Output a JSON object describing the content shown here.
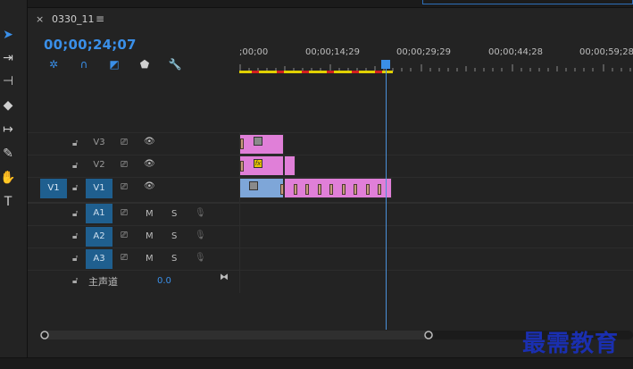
{
  "panel": {
    "close_glyph": "×",
    "title": "0330_11",
    "menu_glyph": "≡",
    "timecode": "00;00;24;07"
  },
  "ruler": {
    "labels": [
      ";00;00",
      "00;00;14;29",
      "00;00;29;29",
      "00;00;44;28",
      "00;00;59;28"
    ]
  },
  "video_tracks": [
    {
      "src": "",
      "target": "V3"
    },
    {
      "src": "",
      "target": "V2"
    },
    {
      "src": "V1",
      "target": "V1"
    }
  ],
  "audio_tracks": [
    {
      "target": "A1",
      "m": "M",
      "s": "S"
    },
    {
      "target": "A2",
      "m": "M",
      "s": "S"
    },
    {
      "target": "A3",
      "m": "M",
      "s": "S"
    }
  ],
  "master": {
    "label": "主声道",
    "value": "0.0"
  },
  "clips": {
    "fx_label": "fx"
  },
  "watermark": "最需教育",
  "colors": {
    "accent": "#3a8fe8",
    "clip_pink": "#e07fd8",
    "clip_blue": "#7ea6d8",
    "work_bar": "#e0d000"
  }
}
